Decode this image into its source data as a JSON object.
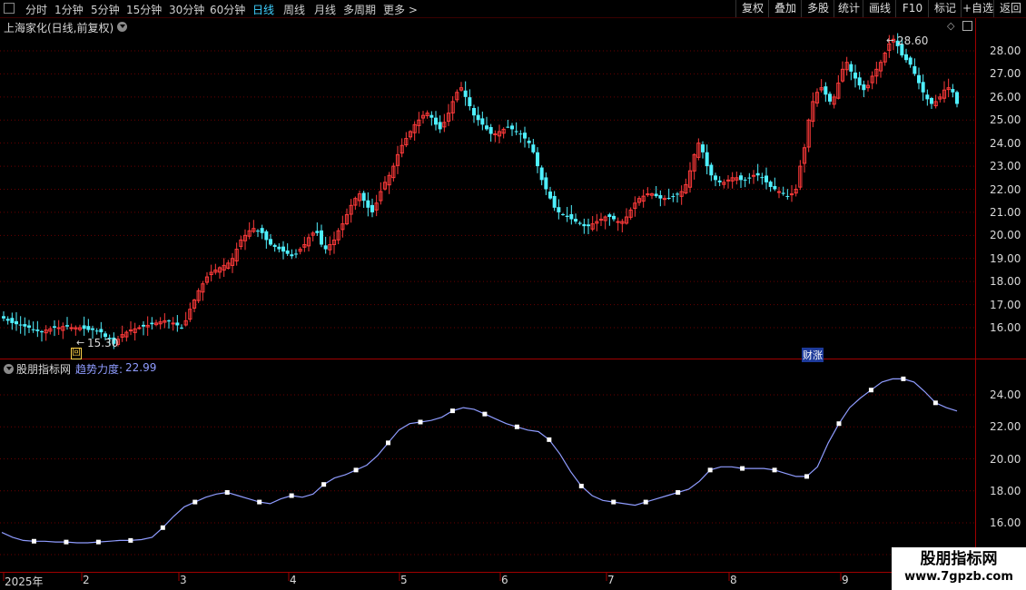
{
  "toolbar": {
    "left_items": [
      "分时",
      "1分钟",
      "5分钟",
      "15分钟",
      "30分钟",
      "60分钟",
      "日线",
      "周线",
      "月线",
      "多周期",
      "更多 >"
    ],
    "active_item": "日线",
    "right_items": [
      "复权",
      "叠加",
      "多股",
      "统计",
      "画线",
      "F10",
      "标记",
      "+自选",
      "返回"
    ]
  },
  "main_panel": {
    "title": "上海家化(日线,前复权)",
    "high_label": "28.60",
    "low_label": "15.30",
    "event_badge": "财涨",
    "low_marker": "回",
    "y_ticks": [
      "28.00",
      "27.00",
      "26.00",
      "25.00",
      "24.00",
      "23.00",
      "22.00",
      "21.00",
      "20.00",
      "19.00",
      "18.00",
      "17.00",
      "16.00"
    ]
  },
  "indicator_panel": {
    "name": "股朋指标网",
    "series_label": "趋势力度:",
    "series_value": "22.99",
    "y_ticks": [
      "24.00",
      "22.00",
      "20.00",
      "18.00",
      "16.00"
    ]
  },
  "x_axis": {
    "labels": [
      "2025年",
      "2",
      "3",
      "4",
      "5",
      "6",
      "7",
      "8",
      "9"
    ]
  },
  "watermark": {
    "line1": "股朋指标网",
    "line2": "www.7gpzb.com"
  },
  "colors": {
    "up": "#ff3a3a",
    "down": "#4ff0ff",
    "grid": "#6a0000",
    "line": "#8f9cff",
    "accent": "#3fd0ff"
  },
  "chart_data": [
    {
      "type": "candlestick",
      "title": "上海家化(日线,前复权)",
      "ylim": [
        15.0,
        28.8
      ],
      "x_range": [
        "2025-01",
        "2025-09"
      ],
      "series": [
        {
          "values": [
            16.4,
            16.3,
            16.2,
            16.15,
            16.1,
            16.05,
            16.0,
            15.9,
            15.85,
            15.8,
            15.9,
            15.95,
            16.0,
            16.0,
            16.05,
            16.05,
            16.0,
            16.0,
            16.0,
            15.95,
            15.9,
            15.9,
            15.85,
            15.8,
            15.6,
            15.5,
            15.3,
            15.5,
            15.7,
            15.8,
            15.9,
            15.95,
            16.0,
            16.05,
            16.1,
            16.15,
            16.2,
            16.25,
            16.3,
            16.3,
            16.2,
            16.1,
            16.0,
            16.3,
            16.8,
            17.2,
            17.6,
            17.9,
            18.2,
            18.4,
            18.5,
            18.6,
            18.7,
            18.8,
            19.0,
            19.4,
            19.8,
            20.0,
            20.2,
            20.3,
            20.2,
            20.1,
            19.8,
            19.6,
            19.5,
            19.4,
            19.3,
            19.2,
            19.1,
            19.2,
            19.4,
            19.6,
            19.9,
            20.1,
            20.1,
            19.6,
            19.4,
            19.6,
            19.8,
            20.2,
            20.5,
            20.9,
            21.3,
            21.6,
            21.8,
            21.5,
            21.2,
            21.0,
            21.4,
            21.9,
            22.3,
            22.6,
            23.0,
            23.5,
            23.9,
            24.2,
            24.5,
            24.8,
            25.0,
            25.2,
            25.3,
            25.1,
            24.8,
            24.6,
            24.9,
            25.3,
            25.8,
            26.2,
            26.4,
            26.0,
            25.6,
            25.2,
            25.0,
            24.8,
            24.6,
            24.4,
            24.4,
            24.5,
            24.6,
            24.7,
            24.6,
            24.5,
            24.4,
            24.2,
            24.0,
            23.6,
            23.0,
            22.4,
            22.0,
            21.6,
            21.2,
            21.0,
            20.9,
            20.8,
            20.7,
            20.6,
            20.5,
            20.4,
            20.4,
            20.5,
            20.6,
            20.7,
            20.8,
            20.8,
            20.7,
            20.6,
            20.6,
            20.8,
            21.1,
            21.4,
            21.6,
            21.7,
            21.8,
            21.8,
            21.7,
            21.6,
            21.6,
            21.6,
            21.7,
            21.8,
            21.9,
            22.2,
            22.8,
            23.5,
            24.0,
            23.6,
            23.0,
            22.6,
            22.4,
            22.3,
            22.3,
            22.4,
            22.5,
            22.5,
            22.4,
            22.4,
            22.5,
            22.6,
            22.6,
            22.5,
            22.3,
            22.1,
            22.0,
            21.9,
            21.8,
            21.7,
            21.8,
            22.0,
            23.0,
            23.8,
            25.0,
            25.8,
            26.2,
            26.4,
            26.1,
            25.8,
            26.0,
            26.6,
            27.2,
            27.5,
            27.1,
            26.8,
            26.5,
            26.3,
            26.5,
            26.9,
            27.2,
            27.5,
            27.9,
            28.3,
            28.5,
            28.2,
            27.8,
            27.6,
            27.4,
            27.0,
            26.6,
            26.2,
            25.9,
            25.7,
            25.8,
            26.0,
            26.3,
            26.4,
            26.2,
            25.7
          ]
        }
      ],
      "annotations": [
        "28.60",
        "15.30",
        "财涨"
      ]
    },
    {
      "type": "line",
      "title": "趋势力度",
      "ylim": [
        15.0,
        26.0
      ],
      "series": [
        {
          "name": "趋势力度",
          "values": [
            15.4,
            15.1,
            14.9,
            14.85,
            14.85,
            14.8,
            14.8,
            14.75,
            14.75,
            14.8,
            14.85,
            14.9,
            14.9,
            14.95,
            15.1,
            15.7,
            16.4,
            17.0,
            17.3,
            17.6,
            17.8,
            17.9,
            17.7,
            17.5,
            17.3,
            17.2,
            17.5,
            17.7,
            17.6,
            17.8,
            18.4,
            18.8,
            19.0,
            19.3,
            19.6,
            20.2,
            21.0,
            21.8,
            22.2,
            22.3,
            22.4,
            22.6,
            23.0,
            23.2,
            23.1,
            22.8,
            22.5,
            22.2,
            22.0,
            21.8,
            21.7,
            21.2,
            20.3,
            19.2,
            18.3,
            17.7,
            17.4,
            17.3,
            17.2,
            17.1,
            17.3,
            17.5,
            17.7,
            17.9,
            18.1,
            18.6,
            19.3,
            19.5,
            19.5,
            19.4,
            19.4,
            19.4,
            19.3,
            19.1,
            18.9,
            18.9,
            19.5,
            21.0,
            22.2,
            23.2,
            23.8,
            24.3,
            24.8,
            25.0,
            25.0,
            24.8,
            24.2,
            23.5,
            23.2,
            22.99
          ]
        }
      ]
    }
  ]
}
